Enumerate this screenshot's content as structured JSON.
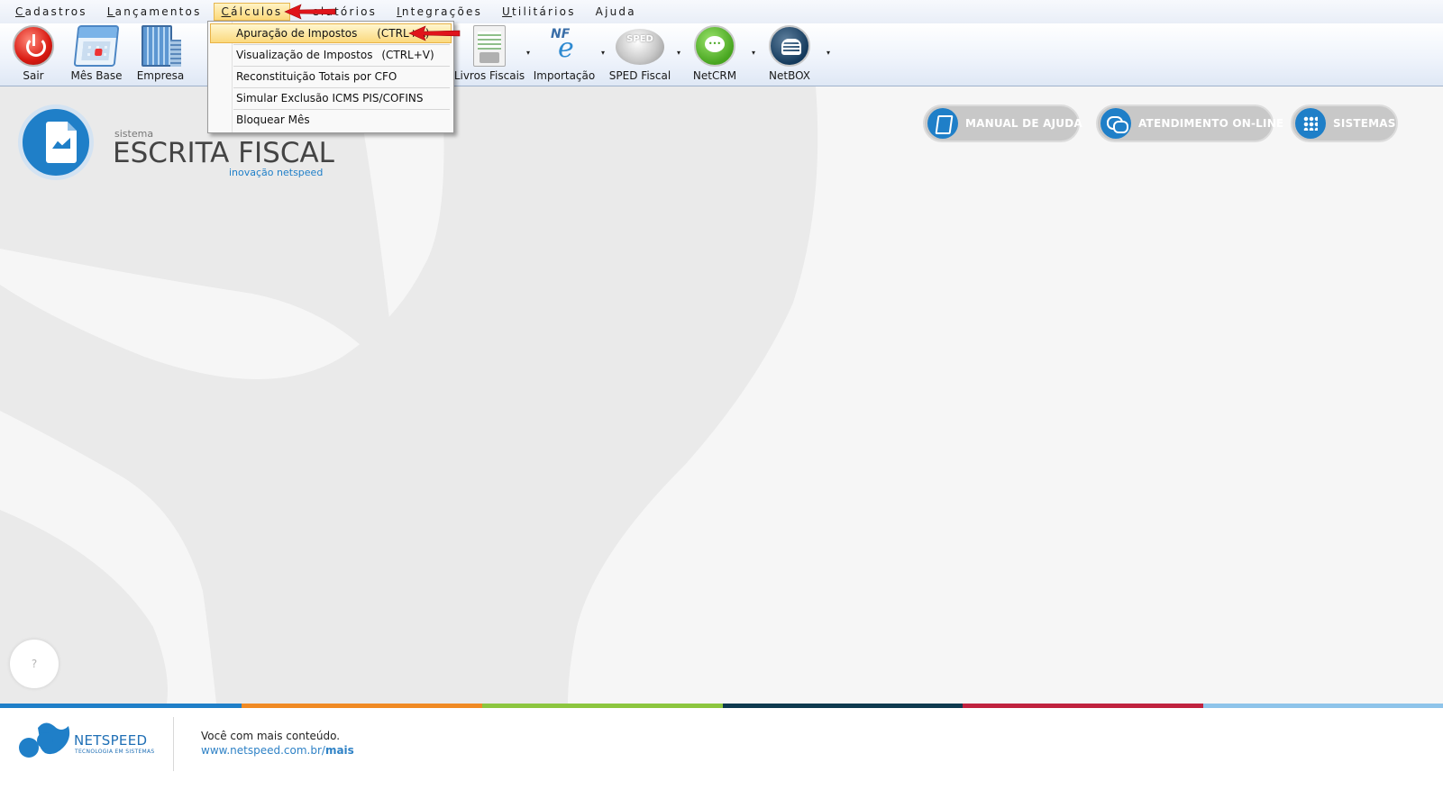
{
  "menubar": {
    "items": [
      {
        "acc": "C",
        "rest": "adastros"
      },
      {
        "acc": "L",
        "rest": "ançamentos"
      },
      {
        "acc": "C",
        "rest": "álculos"
      },
      {
        "acc": "",
        "rest": "elatórios"
      },
      {
        "acc": "I",
        "rest": "ntegrações"
      },
      {
        "acc": "U",
        "rest": "tilitários"
      },
      {
        "acc": "",
        "rest": "Ajuda"
      }
    ],
    "active_index": 2
  },
  "toolbar": {
    "items": [
      {
        "label": "Sair",
        "icon": "power-icon"
      },
      {
        "label": "Mês Base",
        "icon": "calendar-icon"
      },
      {
        "label": "Empresa",
        "icon": "building-icon"
      },
      {
        "label": "Livros Fiscais",
        "icon": "book-printer-icon"
      },
      {
        "label": "Importação",
        "icon": "nfe-icon"
      },
      {
        "label": "SPED Fiscal",
        "icon": "sped-icon"
      },
      {
        "label": "NetCRM",
        "icon": "chat-bubble-icon"
      },
      {
        "label": "NetBOX",
        "icon": "cloud-box-icon"
      }
    ],
    "dropdown_glyph": "▾"
  },
  "calculos_menu": {
    "items": [
      {
        "label": "Apuração de Impostos",
        "shortcut": "(CTRL+A)",
        "highlighted": true
      },
      {
        "label": "Visualização de Impostos",
        "shortcut": "(CTRL+V)",
        "highlighted": false
      },
      {
        "label": "Reconstituição Totais por CFO",
        "shortcut": "",
        "highlighted": false
      },
      {
        "label": "Simular Exclusão ICMS PIS/COFINS",
        "shortcut": "",
        "highlighted": false
      },
      {
        "label": "Bloquear Mês",
        "shortcut": "",
        "highlighted": false
      }
    ]
  },
  "logo": {
    "prefix": "sistema",
    "title": "ESCRITA FISCAL",
    "subtitle": "inovação netspeed"
  },
  "quick_links": [
    {
      "label": "MANUAL DE AJUDA",
      "icon": "book-icon"
    },
    {
      "label": "ATENDIMENTO ON-LINE",
      "icon": "chat-icon"
    },
    {
      "label": "SISTEMAS",
      "icon": "grid-icon"
    }
  ],
  "help_button": {
    "label": "?"
  },
  "footer": {
    "brand": "NETSPEED",
    "brand_tagline": "TECNOLOGIA EM SISTEMAS",
    "message": "Você com mais conteúdo.",
    "link_prefix": "www.netspeed.com.br/",
    "link_bold": "mais"
  },
  "colors": {
    "accent_blue": "#1f7fc8",
    "arrow_red": "#e0141b",
    "stripe": [
      "#1f7fc8",
      "#f08a24",
      "#8cc63f",
      "#0f3a4f",
      "#c0223f",
      "#8ec4ea"
    ]
  }
}
